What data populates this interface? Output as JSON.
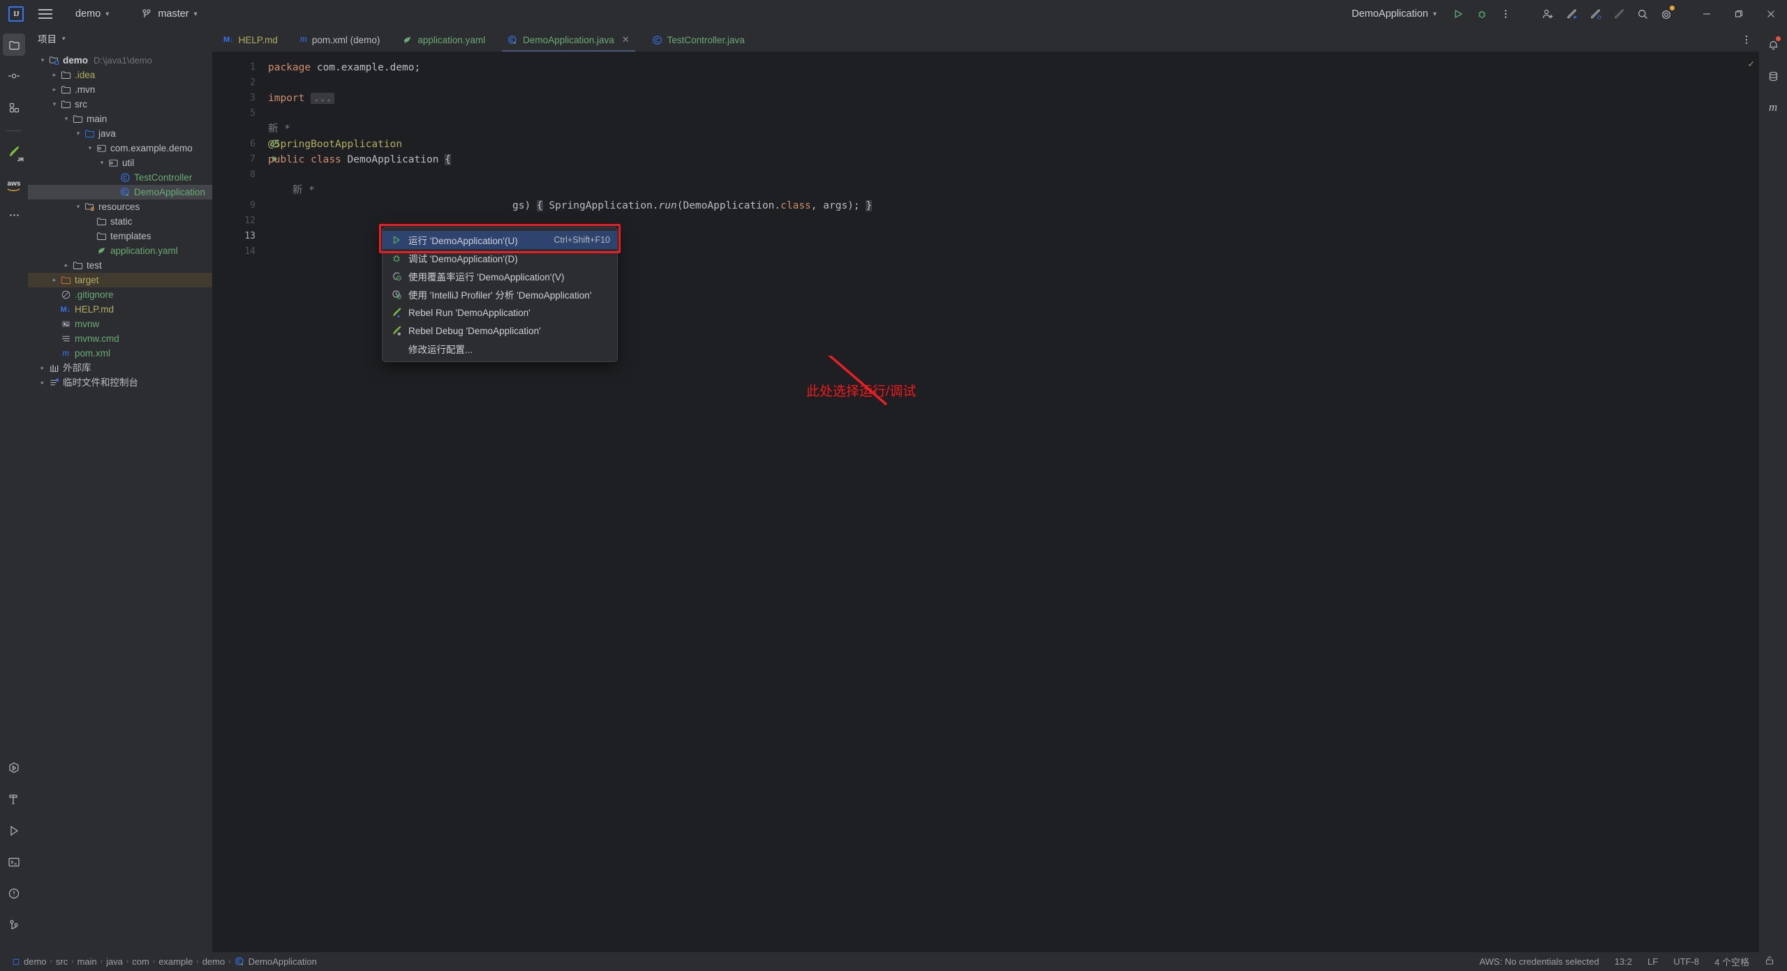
{
  "window": {
    "app_logo": "intellij-idea-logo",
    "project_name": "demo",
    "branch_name": "master",
    "run_config": "DemoApplication",
    "min_label": "−",
    "max_label": "❐",
    "close_label": "✕"
  },
  "toolbar_icons": {
    "menu": "hamburger-icon",
    "run": "run-icon",
    "debug": "debug-icon",
    "more": "more-options-icon",
    "add_user": "add-user-icon",
    "updates": "rocket-blue-icon",
    "notifications": "rocket-zero-icon",
    "rocket_dim": "rocket-dim-icon",
    "search": "search-icon",
    "settings": "settings-gear-icon"
  },
  "left_rail": {
    "top_items": [
      {
        "name": "project-tool-window",
        "icon": "folder-icon",
        "active": true
      },
      {
        "name": "commit-tool-window",
        "icon": "commit-icon",
        "active": false
      },
      {
        "name": "structure-tool-window",
        "icon": "structure-icon",
        "active": false
      }
    ],
    "plugin_items": [
      {
        "name": "jrebel-tool-window",
        "icon": "jrebel-rocket-icon"
      },
      {
        "name": "aws-toolkit-tool-window",
        "icon": "aws-icon"
      },
      {
        "name": "more-tool-windows",
        "icon": "ellipsis-icon"
      }
    ],
    "bottom_items": [
      {
        "name": "run-anything",
        "icon": "hex-play-icon"
      },
      {
        "name": "build-tool-window",
        "icon": "hammer-icon"
      },
      {
        "name": "run-tool-window",
        "icon": "play-outline-icon"
      },
      {
        "name": "terminal-tool-window",
        "icon": "terminal-icon"
      },
      {
        "name": "problems-tool-window",
        "icon": "warning-circle-icon"
      },
      {
        "name": "version-control-tool-window",
        "icon": "branch-icon"
      }
    ]
  },
  "right_rail": {
    "items": [
      {
        "name": "notifications-tool-window",
        "icon": "bell-icon",
        "badge": true
      },
      {
        "name": "database-tool-window",
        "icon": "database-icon",
        "badge": false
      },
      {
        "name": "maven-tool-window",
        "icon": "maven-m-icon",
        "badge": false
      }
    ]
  },
  "project_panel": {
    "title": "项目",
    "tree": [
      {
        "indent": 0,
        "arrow": "⌄",
        "icon": "module-folder-icon",
        "label": "demo",
        "path": "D:\\java1\\demo",
        "style": "bold-plain"
      },
      {
        "indent": 1,
        "arrow": "›",
        "icon": "folder-icon",
        "label": ".idea",
        "style": "yellowish"
      },
      {
        "indent": 1,
        "arrow": "›",
        "icon": "folder-icon",
        "label": ".mvn",
        "style": "plain"
      },
      {
        "indent": 1,
        "arrow": "⌄",
        "icon": "folder-icon",
        "label": "src",
        "style": "plain"
      },
      {
        "indent": 2,
        "arrow": "⌄",
        "icon": "folder-icon",
        "label": "main",
        "style": "plain"
      },
      {
        "indent": 3,
        "arrow": "⌄",
        "icon": "source-folder-icon",
        "label": "java",
        "style": "plain"
      },
      {
        "indent": 4,
        "arrow": "⌄",
        "icon": "package-icon",
        "label": "com.example.demo",
        "style": "plain"
      },
      {
        "indent": 5,
        "arrow": "⌄",
        "icon": "package-icon",
        "label": "util",
        "style": "plain"
      },
      {
        "indent": 6,
        "arrow": "",
        "icon": "java-class-icon",
        "label": "TestController",
        "style": "green"
      },
      {
        "indent": 6,
        "arrow": "",
        "icon": "spring-class-icon",
        "label": "DemoApplication",
        "style": "green",
        "selected": true
      },
      {
        "indent": 3,
        "arrow": "⌄",
        "icon": "resources-folder-icon",
        "label": "resources",
        "style": "plain"
      },
      {
        "indent": 4,
        "arrow": "",
        "icon": "folder-icon",
        "label": "static",
        "style": "plain"
      },
      {
        "indent": 4,
        "arrow": "",
        "icon": "folder-icon",
        "label": "templates",
        "style": "plain"
      },
      {
        "indent": 4,
        "arrow": "",
        "icon": "spring-yaml-icon",
        "label": "application.yaml",
        "style": "green"
      },
      {
        "indent": 2,
        "arrow": "›",
        "icon": "folder-icon",
        "label": "test",
        "style": "plain"
      },
      {
        "indent": 1,
        "arrow": "›",
        "icon": "excluded-folder-icon",
        "label": "target",
        "style": "yellowish",
        "highlight": "target"
      },
      {
        "indent": 1,
        "arrow": "",
        "icon": "gitignore-icon",
        "label": ".gitignore",
        "style": "green"
      },
      {
        "indent": 1,
        "arrow": "",
        "icon": "markdown-icon",
        "label": "HELP.md",
        "style": "yellowish"
      },
      {
        "indent": 1,
        "arrow": "",
        "icon": "shell-script-icon",
        "label": "mvnw",
        "style": "green"
      },
      {
        "indent": 1,
        "arrow": "",
        "icon": "cmd-file-icon",
        "label": "mvnw.cmd",
        "style": "green"
      },
      {
        "indent": 1,
        "arrow": "",
        "icon": "maven-pom-icon",
        "label": "pom.xml",
        "style": "green"
      },
      {
        "indent": 0,
        "arrow": "›",
        "icon": "external-libraries-icon",
        "label": "外部库",
        "style": "plain"
      },
      {
        "indent": 0,
        "arrow": "›",
        "icon": "scratches-icon",
        "label": "临时文件和控制台",
        "style": "plain"
      }
    ]
  },
  "editor": {
    "tabs": [
      {
        "label": "HELP.md",
        "icon": "markdown-icon",
        "active": false,
        "style": "yellowish"
      },
      {
        "label": "pom.xml (demo)",
        "icon": "maven-pom-icon",
        "active": false,
        "style": "plain"
      },
      {
        "label": "application.yaml",
        "icon": "spring-yaml-icon",
        "active": false,
        "style": "green"
      },
      {
        "label": "DemoApplication.java",
        "icon": "spring-class-icon",
        "active": true,
        "style": "green",
        "closable": true
      },
      {
        "label": "TestController.java",
        "icon": "java-class-icon",
        "active": false,
        "style": "green"
      }
    ],
    "tab_close_glyph": "✕",
    "options_icon": "editor-options-icon",
    "inspection_status": "✓",
    "line_numbers": [
      "1",
      "2",
      "3",
      "5",
      "",
      "6",
      "7",
      "8",
      "",
      "9",
      "12",
      "13",
      "14"
    ],
    "code_lines": [
      {
        "tokens": [
          {
            "t": "package",
            "c": "kw"
          },
          {
            "t": " com.example.demo;",
            "c": ""
          }
        ]
      },
      {
        "tokens": []
      },
      {
        "tokens": [
          {
            "t": "import",
            "c": "kw"
          },
          {
            "t": " ",
            "c": ""
          },
          {
            "t": "...",
            "c": "fold"
          }
        ]
      },
      {
        "tokens": []
      },
      {
        "tokens": [
          {
            "t": "新 *",
            "c": "cmt"
          }
        ]
      },
      {
        "tokens": [
          {
            "t": "@SpringBootApplication",
            "c": "ann"
          }
        ]
      },
      {
        "tokens": [
          {
            "t": "public",
            "c": "kw"
          },
          {
            "t": " ",
            "c": ""
          },
          {
            "t": "class",
            "c": "kw"
          },
          {
            "t": " DemoApplication ",
            "c": ""
          },
          {
            "t": "{",
            "c": "brace-hl"
          }
        ]
      },
      {
        "tokens": []
      },
      {
        "tokens": [
          {
            "t": "    新 *",
            "c": "cmt"
          }
        ]
      },
      {
        "tokens": [
          {
            "t": "gs) ",
            "c": ""
          },
          {
            "t": "{",
            "c": "brace-hl"
          },
          {
            "t": " SpringApplication.",
            "c": ""
          },
          {
            "t": "run",
            "c": "ital"
          },
          {
            "t": "(DemoApplication.",
            "c": ""
          },
          {
            "t": "class",
            "c": "kw"
          },
          {
            "t": ", args); ",
            "c": ""
          },
          {
            "t": "}",
            "c": "brace-hl"
          }
        ]
      },
      {
        "tokens": []
      },
      {
        "tokens": []
      },
      {
        "tokens": []
      }
    ],
    "gutter_marks": [
      {
        "line_index": 5,
        "icon": "spring-bean-icon"
      },
      {
        "line_index": 6,
        "icon": "run-gutter-icon"
      }
    ]
  },
  "context_menu": {
    "items": [
      {
        "label": "运行 'DemoApplication'(U)",
        "shortcut": "Ctrl+Shift+F10",
        "icon": "run-green-icon",
        "selected": true
      },
      {
        "label": "调试 'DemoApplication'(D)",
        "shortcut": "",
        "icon": "debug-green-icon",
        "selected": false
      },
      {
        "label": "使用覆盖率运行 'DemoApplication'(V)",
        "shortcut": "",
        "icon": "coverage-icon",
        "selected": false
      },
      {
        "label": "使用 'IntelliJ Profiler' 分析 'DemoApplication'",
        "shortcut": "",
        "icon": "profiler-icon",
        "selected": false
      },
      {
        "label": "Rebel Run 'DemoApplication'",
        "shortcut": "",
        "icon": "jrebel-run-icon",
        "selected": false
      },
      {
        "label": "Rebel Debug 'DemoApplication'",
        "shortcut": "",
        "icon": "jrebel-debug-icon",
        "selected": false
      },
      {
        "label": "修改运行配置...",
        "shortcut": "",
        "icon": "",
        "selected": false
      }
    ]
  },
  "annotation": {
    "text": "此处选择运行/调试",
    "color": "#f01a1a"
  },
  "status_bar": {
    "breadcrumbs": [
      {
        "label": "demo",
        "icon": "module-icon"
      },
      {
        "label": "src"
      },
      {
        "label": "main"
      },
      {
        "label": "java"
      },
      {
        "label": "com"
      },
      {
        "label": "example"
      },
      {
        "label": "demo"
      },
      {
        "label": "DemoApplication",
        "icon": "spring-class-icon"
      }
    ],
    "separator": "›",
    "right": {
      "aws": "AWS: No credentials selected",
      "caret": "13:2",
      "line_separator": "LF",
      "encoding": "UTF-8",
      "indent": "4 个空格",
      "lock_icon": "unlocked-icon"
    }
  },
  "colors": {
    "accent_blue": "#3574f0",
    "selection_bg": "#2e436e",
    "annotation_red": "#e81f24",
    "green_text": "#6aab73",
    "panel_bg": "#2b2d30",
    "editor_bg": "#1e1f22"
  }
}
